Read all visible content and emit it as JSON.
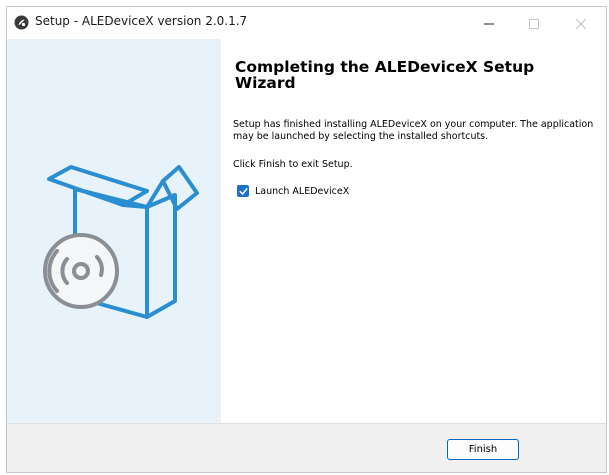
{
  "window": {
    "title": "Setup - ALEDeviceX version 2.0.1.7"
  },
  "icons": {
    "app": "app-icon",
    "minimize": "minimize-icon",
    "maximize": "maximize-icon",
    "close": "close-icon",
    "illustration": "software-box-cd-icon",
    "check": "checkmark-icon"
  },
  "content": {
    "heading": "Completing the ALEDeviceX Setup Wizard",
    "message": "Setup has finished installing ALEDeviceX on your computer. The application may be launched by selecting the installed shortcuts.",
    "exit_hint": "Click Finish to exit Setup.",
    "launch_checkbox": {
      "label": "Launch ALEDeviceX",
      "checked": true
    }
  },
  "footer": {
    "finish_label": "Finish"
  },
  "colors": {
    "sidebar_bg": "#e7f2fa",
    "illustration_stroke": "#2a8fd1",
    "checkbox_fill": "#1f6fd1",
    "button_border": "#0067c0"
  }
}
